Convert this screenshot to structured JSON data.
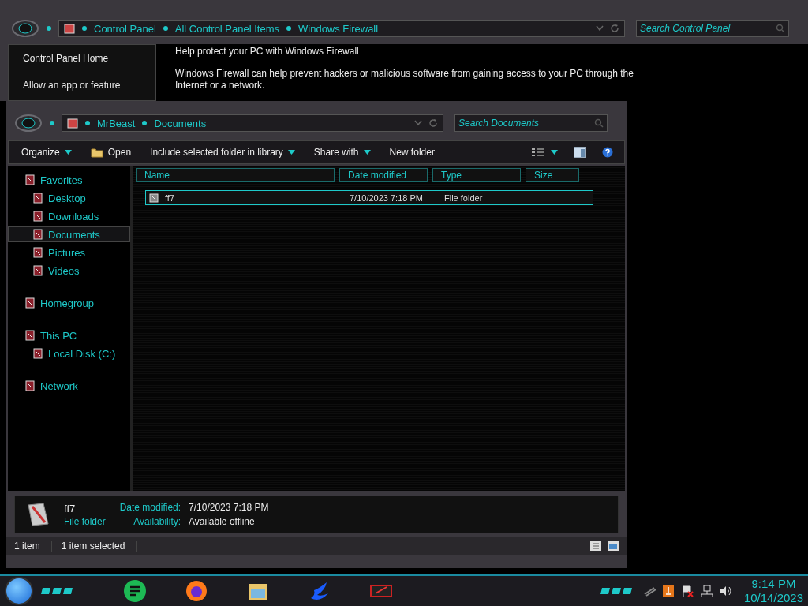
{
  "back_window": {
    "breadcrumb": [
      "Control Panel",
      "All Control Panel Items",
      "Windows Firewall"
    ],
    "search": {
      "placeholder": "Search Control Panel"
    },
    "links": [
      "Control Panel Home",
      "Allow an app or feature"
    ],
    "heading": "Help protect your PC with Windows Firewall",
    "description": "Windows Firewall can help prevent hackers or malicious software from gaining access to your PC through the Internet or a network."
  },
  "explorer": {
    "breadcrumb": [
      "MrBeast",
      "Documents"
    ],
    "search": {
      "placeholder": "Search Documents"
    },
    "toolbar": [
      {
        "label": "Organize",
        "kind": "menu"
      },
      {
        "label": "Open",
        "kind": "icon"
      },
      {
        "label": "Include selected folder in library",
        "kind": "menu"
      },
      {
        "label": "Share with",
        "kind": "menu"
      },
      {
        "label": "New folder",
        "kind": "plain"
      }
    ],
    "sidebar": [
      {
        "label": "Favorites",
        "selected": false,
        "children": [
          {
            "label": "Desktop",
            "selected": false
          },
          {
            "label": "Downloads",
            "selected": false
          },
          {
            "label": "Documents",
            "selected": true
          },
          {
            "label": "Pictures",
            "selected": false
          },
          {
            "label": "Videos",
            "selected": false
          }
        ]
      },
      {
        "label": "Homegroup",
        "selected": false
      },
      {
        "label": "This PC",
        "selected": false,
        "children": [
          {
            "label": "Local Disk (C:)",
            "selected": false
          }
        ]
      },
      {
        "label": "Network",
        "selected": false
      }
    ],
    "columns": [
      "Name",
      "Date modified",
      "Type",
      "Size"
    ],
    "rows": [
      {
        "name": "ff7",
        "date_modified": "7/10/2023 7:18 PM",
        "type": "File folder",
        "selected": true
      }
    ],
    "details": {
      "name": "ff7",
      "type": "File folder",
      "fields": [
        {
          "label": "Date modified:",
          "value": "7/10/2023 7:18 PM"
        },
        {
          "label": "Availability:",
          "value": "Available offline"
        }
      ]
    },
    "status_bar": [
      "1 item",
      "1 item selected"
    ]
  },
  "taskbar": {
    "time": "9:14 PM",
    "date": "10/14/2023"
  }
}
